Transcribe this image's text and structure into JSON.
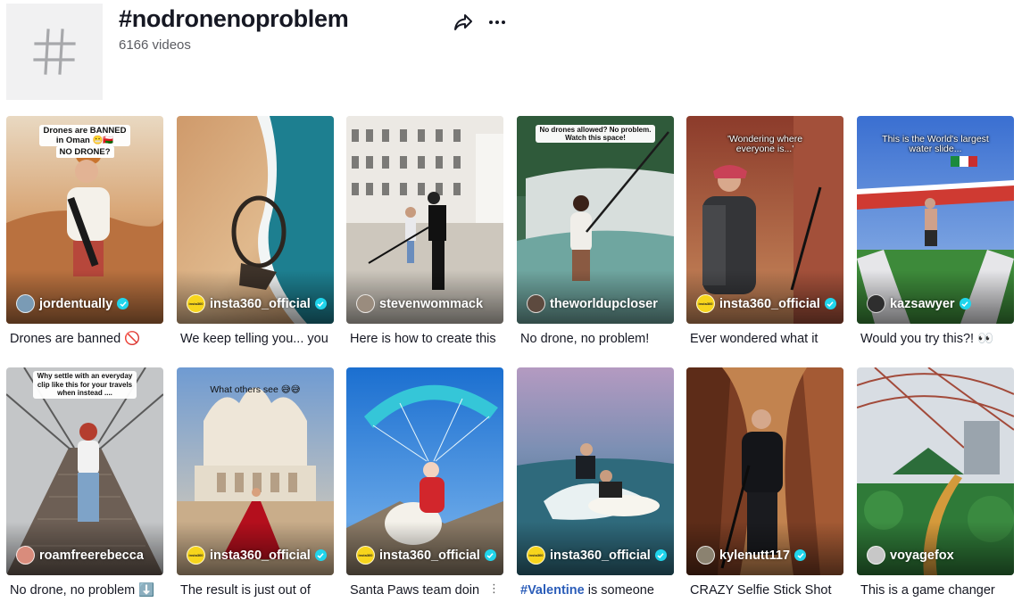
{
  "header": {
    "title": "#nodronenoproblem",
    "video_count": "6166 videos"
  },
  "videos": [
    {
      "author": "jordentually",
      "verified": true,
      "description": "Drones are banned 🚫",
      "overlay": "Drones are BANNED\nin Oman 😬🇴🇲",
      "overlay2": "NO DRONE?"
    },
    {
      "author": "insta360_official",
      "verified": true,
      "description": "We keep telling you... you",
      "overlay": ""
    },
    {
      "author": "stevenwommack",
      "verified": false,
      "description": "Here is how to create this",
      "overlay": ""
    },
    {
      "author": "theworldupcloser",
      "verified": false,
      "description": "No drone, no problem!",
      "overlay": "No drones allowed? No problem.\nWatch this space!"
    },
    {
      "author": "insta360_official",
      "verified": true,
      "description": "Ever wondered what it",
      "overlay": "'Wondering where\neveryone is...'"
    },
    {
      "author": "kazsawyer",
      "verified": true,
      "description": "Would you try this?! 👀",
      "overlay": "This is the World's largest\nwater slide..."
    },
    {
      "author": "roamfreerebecca",
      "verified": false,
      "description": "No drone, no problem ⬇️",
      "overlay": "Why settle with an everyday\nclip like this for your travels\nwhen instead ...."
    },
    {
      "author": "insta360_official",
      "verified": true,
      "description": "The result is just out of",
      "overlay": "What others see 😅😅"
    },
    {
      "author": "insta360_official",
      "verified": true,
      "description": "Santa Paws team doin",
      "overlay": ""
    },
    {
      "author": "insta360_official",
      "verified": true,
      "description_hashtag": "#Valentine",
      "description": " is someone",
      "overlay": ""
    },
    {
      "author": "kylenutt117",
      "verified": true,
      "description": "CRAZY Selfie Stick Shot",
      "overlay": ""
    },
    {
      "author": "voyagefox",
      "verified": false,
      "description": "This is a game changer",
      "overlay": ""
    }
  ],
  "brand_badge": "insta360",
  "icons": {
    "hashtag": "hashtag-icon",
    "share": "share-icon",
    "more": "more-icon",
    "verified": "verified-check-icon"
  },
  "colors": {
    "verified": "#20d5ec",
    "hashtag_link": "#2b5db9",
    "insta360_brand": "#f7d51c"
  }
}
